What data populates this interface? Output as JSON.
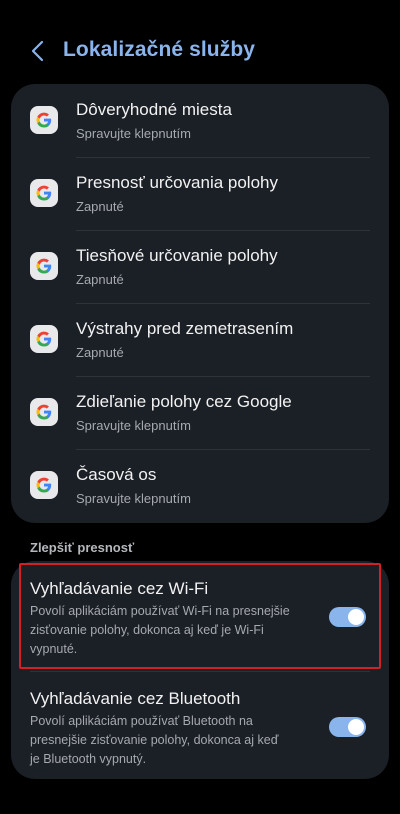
{
  "header": {
    "title": "Lokalizačné služby",
    "back_icon": "chevron-left-icon"
  },
  "colors": {
    "accent": "#8ab4ec",
    "background": "#000000",
    "card": "#1b1f26",
    "highlight": "#d32027"
  },
  "services": [
    {
      "title": "Dôveryhodné miesta",
      "subtitle": "Spravujte klepnutím",
      "icon": "google-icon"
    },
    {
      "title": "Presnosť určovania polohy",
      "subtitle": "Zapnuté",
      "icon": "google-icon"
    },
    {
      "title": "Tiesňové určovanie polohy",
      "subtitle": "Zapnuté",
      "icon": "google-icon"
    },
    {
      "title": "Výstrahy pred zemetrasením",
      "subtitle": "Zapnuté",
      "icon": "google-icon"
    },
    {
      "title": "Zdieľanie polohy cez Google",
      "subtitle": "Spravujte klepnutím",
      "icon": "google-icon"
    },
    {
      "title": "Časová os",
      "subtitle": "Spravujte klepnutím",
      "icon": "google-icon"
    }
  ],
  "improve_section": {
    "label": "Zlepšiť presnosť",
    "items": [
      {
        "title": "Vyhľadávanie cez Wi-Fi",
        "description_lines": [
          "Povolí aplikáciám používať Wi-Fi na presnejšie",
          "zisťovanie polohy, dokonca aj keď je Wi-Fi",
          "vypnuté."
        ],
        "enabled": true
      },
      {
        "title": "Vyhľadávanie cez Bluetooth",
        "description_lines": [
          "Povolí aplikáciám používať Bluetooth na",
          "presnejšie zisťovanie polohy, dokonca aj keď",
          "je Bluetooth vypnutý."
        ],
        "enabled": true
      }
    ]
  }
}
